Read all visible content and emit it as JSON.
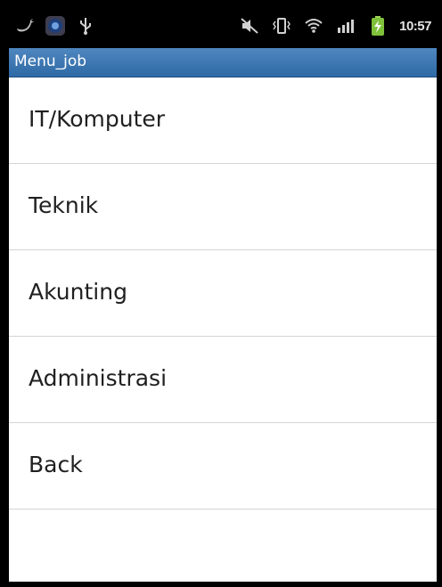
{
  "status_bar": {
    "time": "10:57",
    "left_icons": [
      "twitter-icon",
      "app-icon",
      "usb-icon"
    ],
    "right_icons": [
      "mute-icon",
      "vibrate-icon",
      "wifi-icon",
      "signal-icon",
      "battery-charging-icon"
    ]
  },
  "app": {
    "title": "Menu_job"
  },
  "menu": {
    "items": [
      {
        "label": "IT/Komputer"
      },
      {
        "label": "Teknik"
      },
      {
        "label": "Akunting"
      },
      {
        "label": "Administrasi"
      },
      {
        "label": "Back"
      }
    ]
  },
  "colors": {
    "title_bar": "#3a76b1",
    "background": "#ffffff",
    "divider": "#d4d4d4",
    "status_bar": "#000000"
  }
}
